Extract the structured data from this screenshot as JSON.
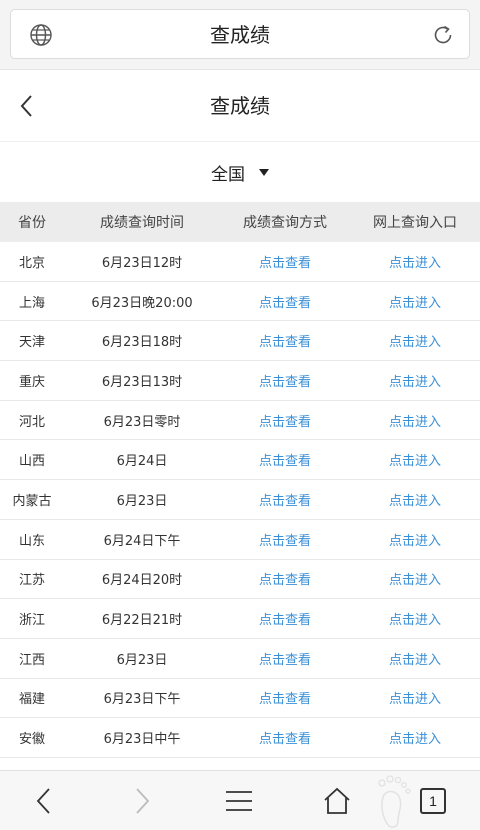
{
  "browser": {
    "address_title": "查成绩",
    "tab_count": "1"
  },
  "header": {
    "title": "查成绩"
  },
  "region": {
    "selected": "全国"
  },
  "table": {
    "columns": [
      "省份",
      "成绩查询时间",
      "成绩查询方式",
      "网上查询入口"
    ],
    "rows": [
      {
        "province": "北京",
        "time": "6月23日12时",
        "method": "点击查看",
        "entry": "点击进入"
      },
      {
        "province": "上海",
        "time": "6月23日晚20:00",
        "method": "点击查看",
        "entry": "点击进入"
      },
      {
        "province": "天津",
        "time": "6月23日18时",
        "method": "点击查看",
        "entry": "点击进入"
      },
      {
        "province": "重庆",
        "time": "6月23日13时",
        "method": "点击查看",
        "entry": "点击进入"
      },
      {
        "province": "河北",
        "time": "6月23日零时",
        "method": "点击查看",
        "entry": "点击进入"
      },
      {
        "province": "山西",
        "time": "6月24日",
        "method": "点击查看",
        "entry": "点击进入"
      },
      {
        "province": "内蒙古",
        "time": "6月23日",
        "method": "点击查看",
        "entry": "点击进入"
      },
      {
        "province": "山东",
        "time": "6月24日下午",
        "method": "点击查看",
        "entry": "点击进入"
      },
      {
        "province": "江苏",
        "time": "6月24日20时",
        "method": "点击查看",
        "entry": "点击进入"
      },
      {
        "province": "浙江",
        "time": "6月22日21时",
        "method": "点击查看",
        "entry": "点击进入"
      },
      {
        "province": "江西",
        "time": "6月23日",
        "method": "点击查看",
        "entry": "点击进入"
      },
      {
        "province": "福建",
        "time": "6月23日下午",
        "method": "点击查看",
        "entry": "点击进入"
      },
      {
        "province": "安徽",
        "time": "6月23日中午",
        "method": "点击查看",
        "entry": "点击进入"
      }
    ]
  },
  "colors": {
    "link": "#3b8fd6",
    "header_bg": "#ececec"
  },
  "icons": {
    "address_left": "globe-icon",
    "address_right": "reload-icon",
    "header_left": "back-arrow-icon",
    "toolbar": [
      "back-icon",
      "forward-icon",
      "menu-icon",
      "home-icon",
      "tabs-icon"
    ]
  }
}
